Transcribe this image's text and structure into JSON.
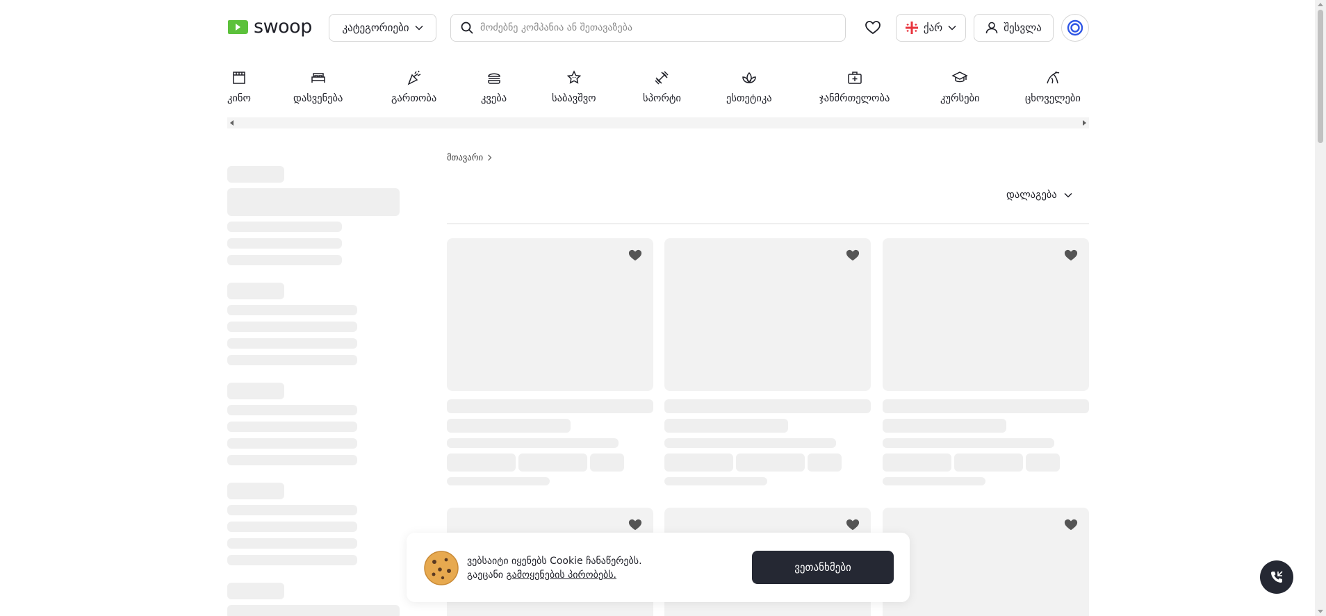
{
  "header": {
    "logo_text": "swoop",
    "categories_label": "კატეგორიები",
    "search_placeholder": "მოძებნე კომპანია ან შეთავაზება",
    "language_label": "ქარ",
    "login_label": "შესვლა"
  },
  "categories": [
    {
      "label": "კინო",
      "icon": "cinema-icon"
    },
    {
      "label": "დასვენება",
      "icon": "bed-icon"
    },
    {
      "label": "გართობა",
      "icon": "party-icon"
    },
    {
      "label": "კვება",
      "icon": "burger-icon"
    },
    {
      "label": "საბავშვო",
      "icon": "kids-star-icon"
    },
    {
      "label": "სპორტი",
      "icon": "dumbbell-icon"
    },
    {
      "label": "ესთეტიკა",
      "icon": "lotus-icon"
    },
    {
      "label": "ჯანმრთელობა",
      "icon": "medkit-icon"
    },
    {
      "label": "კურსები",
      "icon": "graduation-cap-icon"
    },
    {
      "label": "ცხოველები",
      "icon": "pet-icon"
    }
  ],
  "breadcrumb": {
    "home": "მთავარი"
  },
  "sort": {
    "label": "დალაგება"
  },
  "cookie": {
    "line1": "ვებსაიტი იყენებს Cookie ჩანაწერებს.",
    "line2_prefix": "გაეცანი ",
    "line2_link": "გამოყენების პირობებს.",
    "agree_label": "ვეთანხმები"
  },
  "colors": {
    "brand_green": "#5cc13b",
    "dark": "#252833",
    "skeleton": "#efefef",
    "georgian_flag_red": "#e8333c",
    "ring_blue": "#2f56e5"
  }
}
